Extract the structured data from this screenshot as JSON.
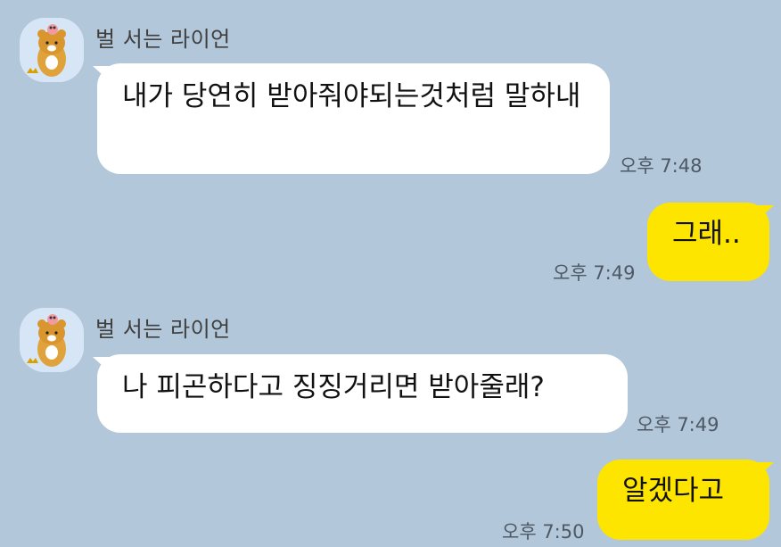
{
  "chat": {
    "messages": [
      {
        "sender": "벌 서는 라이언",
        "avatar_icon": "ryan-character-icon",
        "text": "내가 당연히 받아줘야되는것처럼 말하내",
        "time": "오후 7:48"
      },
      {
        "text": "그래..",
        "time": "오후 7:49"
      },
      {
        "sender": "벌 서는 라이언",
        "avatar_icon": "ryan-character-icon",
        "text": "나 피곤하다고 징징거리면 받아줄래?",
        "time": "오후 7:49"
      },
      {
        "text": "알겠다고",
        "time": "오후 7:50"
      }
    ]
  },
  "colors": {
    "background": "#b2c7da",
    "incoming_bubble": "#ffffff",
    "outgoing_bubble": "#fee500"
  }
}
